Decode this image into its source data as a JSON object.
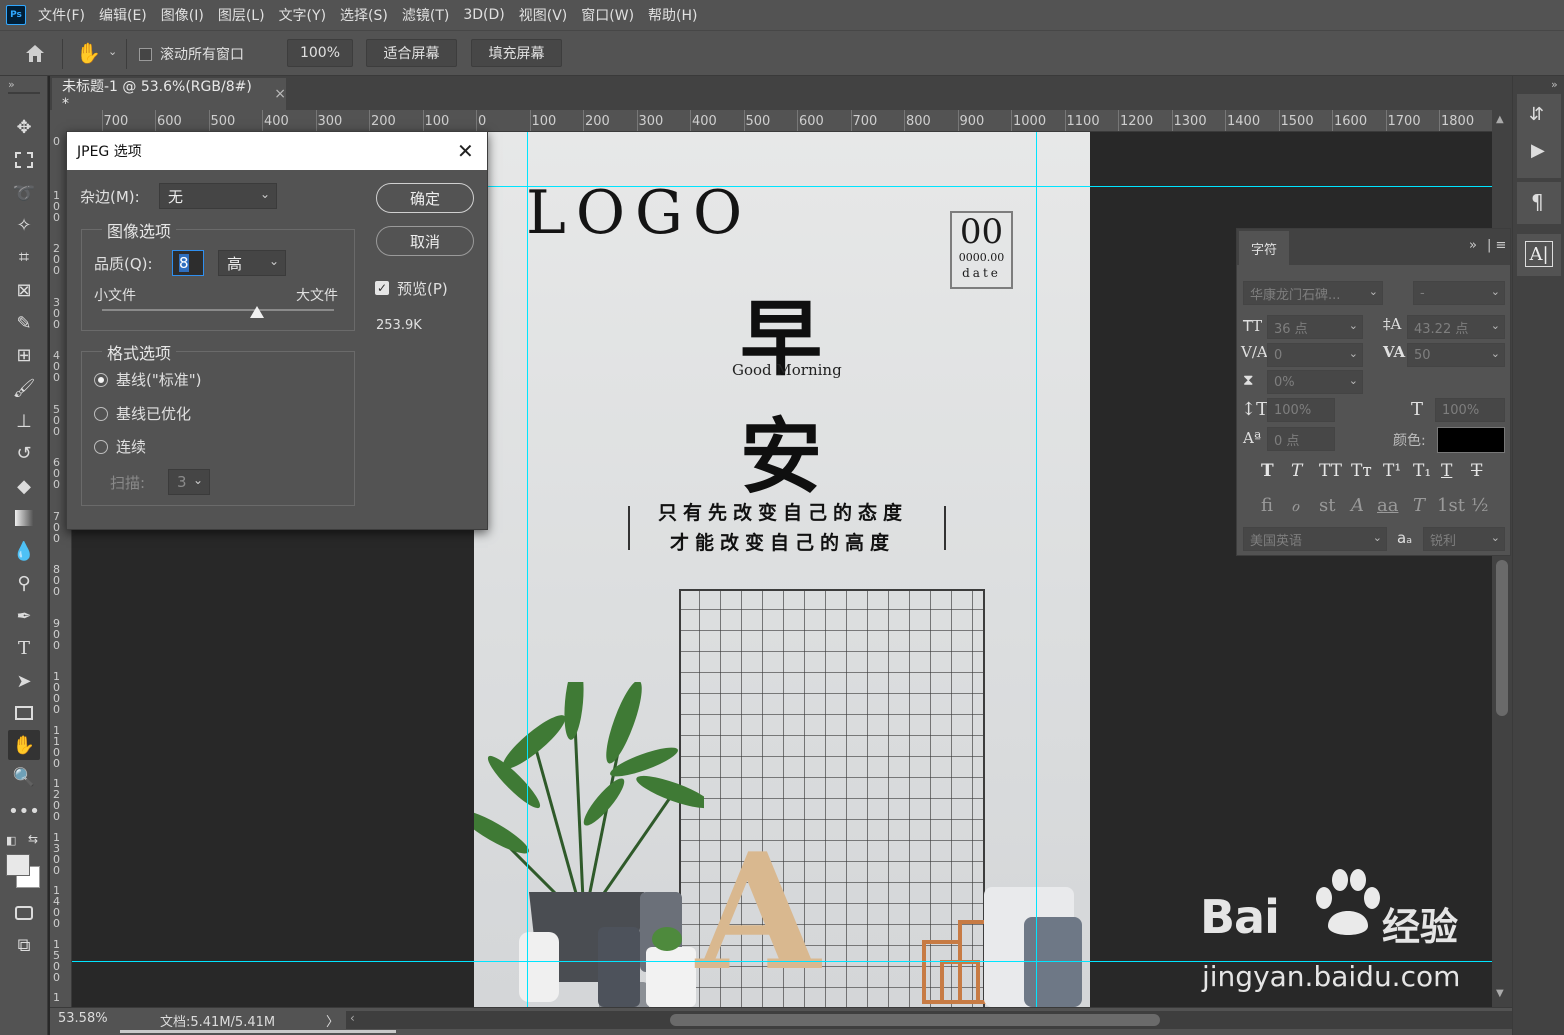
{
  "menu": {
    "logo": "Ps",
    "items": [
      "文件(F)",
      "编辑(E)",
      "图像(I)",
      "图层(L)",
      "文字(Y)",
      "选择(S)",
      "滤镜(T)",
      "3D(D)",
      "视图(V)",
      "窗口(W)",
      "帮助(H)"
    ]
  },
  "options": {
    "scroll_all_label": "滚动所有窗口",
    "zoom_value": "100%",
    "fit_screen": "适合屏幕",
    "fill_screen": "填充屏幕"
  },
  "document": {
    "tab_title": "未标题-1 @ 53.6%(RGB/8#) *",
    "close": "×"
  },
  "ruler": {
    "top_labels": [
      "700",
      "600",
      "500",
      "400",
      "300",
      "200",
      "100",
      "0",
      "100",
      "200",
      "300",
      "400",
      "500",
      "600",
      "700",
      "800",
      "900",
      "1000",
      "1100",
      "1200",
      "1300",
      "1400",
      "1500",
      "1600",
      "1700",
      "1800"
    ],
    "left_labels": [
      "0",
      "100",
      "200",
      "300",
      "400",
      "500",
      "600",
      "700",
      "800",
      "900",
      "1000",
      "1100",
      "1200",
      "1300",
      "1400",
      "1500",
      "1"
    ]
  },
  "poster": {
    "logo": "LOGO",
    "date_big": "00",
    "date_small": "0000.00",
    "date_word": "date",
    "char1": "早",
    "subtitle": "Good Morning",
    "char2": "安",
    "line1": "只有先改变自己的态度",
    "line2": "才能改变自己的高度",
    "letter": "A"
  },
  "status": {
    "zoom": "53.58%",
    "doc_size": "文档:5.41M/5.41M",
    "arrow": "〉"
  },
  "jpeg_dialog": {
    "title": "JPEG 选项",
    "matte_label": "杂边(M):",
    "matte_value": "无",
    "image_options_title": "图像选项",
    "quality_label": "品质(Q):",
    "quality_value": "8",
    "quality_level": "高",
    "small_file": "小文件",
    "large_file": "大文件",
    "quality_slider_fraction": 0.67,
    "format_options_title": "格式选项",
    "format_options": [
      "基线(\"标准\")",
      "基线已优化",
      "连续"
    ],
    "selected_format_index": 0,
    "scans_label": "扫描:",
    "scans_value": "3",
    "ok_button": "确定",
    "cancel_button": "取消",
    "preview_label": "预览(P)",
    "preview_checked": true,
    "file_size": "253.9K"
  },
  "character_panel": {
    "tab": "字符",
    "font_family": "华康龙门石碑...",
    "font_style": "-",
    "font_size": "36 点",
    "leading": "43.22 点",
    "kerning": "0",
    "tracking": "50",
    "scale_proportion": "0%",
    "vertical_scale": "100%",
    "horizontal_scale": "100%",
    "baseline_shift": "0 点",
    "color_label": "颜色:",
    "color_swatch": "#000000",
    "language": "美国英语",
    "aa_icon": "aₐ",
    "antialias": "锐利",
    "style_buttons": [
      "T",
      "T",
      "TT",
      "Tт",
      "T¹",
      "T₁",
      "T",
      "T"
    ],
    "opentype_buttons": [
      "ﬁ",
      "ℴ",
      "st",
      "A",
      "aa",
      "T",
      "1st",
      "½"
    ]
  },
  "watermark": {
    "brand": "Bai",
    "brand2": "经验",
    "url": "jingyan.baidu.com"
  },
  "colors": {
    "accent_guide": "#00e5ff",
    "panel_bg": "#535353",
    "canvas_bg": "#282828"
  }
}
